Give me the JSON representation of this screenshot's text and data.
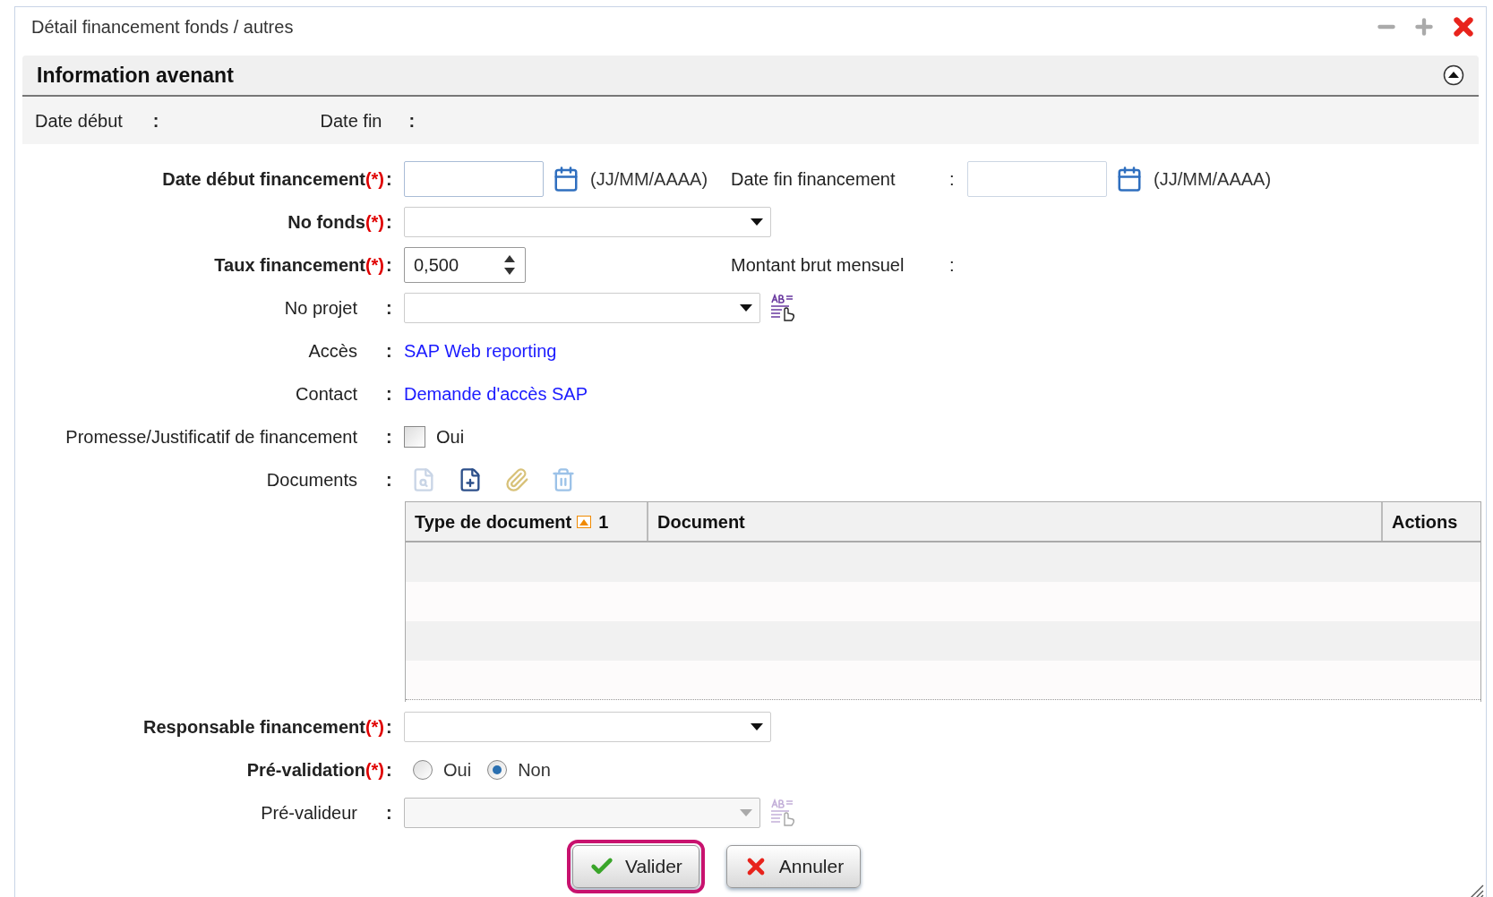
{
  "window": {
    "title": "Détail financement fonds / autres"
  },
  "section": {
    "title": "Information avenant",
    "expanded": true
  },
  "summary": [
    {
      "label": "Date début",
      "colon": ":"
    },
    {
      "label": "Date fin",
      "colon": ":"
    }
  ],
  "rows": [
    {
      "kind": "date",
      "label": "Date début financement",
      "required_mark": "(*)",
      "colon": ":",
      "hint": "(JJ/MM/AAAA)",
      "extra": {
        "kind": "date",
        "label": "Date fin financement",
        "colon": ":",
        "hint": "(JJ/MM/AAAA)"
      }
    },
    {
      "kind": "select",
      "label": "No fonds",
      "required_mark": "(*)",
      "colon": ":"
    },
    {
      "kind": "spinner",
      "label": "Taux financement",
      "required_mark": "(*)",
      "colon": ":",
      "value": "0,500",
      "extra": {
        "kind": "text",
        "label": "Montant brut mensuel",
        "colon": ":"
      }
    },
    {
      "kind": "lookup",
      "label": "No projet",
      "colon": ":",
      "disabled": false
    },
    {
      "kind": "link",
      "label": "Accès",
      "colon": ":",
      "link": "SAP Web reporting"
    },
    {
      "kind": "link",
      "label": "Contact",
      "colon": ":",
      "link": "Demande d'accès SAP"
    },
    {
      "kind": "checkbox",
      "label": "Promesse/Justificatif de financement",
      "colon": ":",
      "option": "Oui",
      "checked": false
    },
    {
      "kind": "documents",
      "label": "Documents",
      "colon": ":",
      "table": {
        "columns": [
          {
            "label": "Type de document",
            "sort_order": "1"
          },
          {
            "label": "Document"
          },
          {
            "label": "Actions"
          }
        ]
      }
    },
    {
      "kind": "select",
      "label": "Responsable financement",
      "required_mark": "(*)",
      "colon": ":"
    },
    {
      "kind": "radio",
      "label": "Pré-validation",
      "required_mark": "(*)",
      "colon": ":",
      "options": [
        {
          "label": "Oui",
          "selected": false
        },
        {
          "label": "Non",
          "selected": true
        }
      ]
    },
    {
      "kind": "lookup",
      "label": "Pré-valideur",
      "colon": ":",
      "disabled": true
    }
  ],
  "buttons": [
    {
      "kind": "confirm",
      "label": "Valider",
      "focused": true
    },
    {
      "kind": "cancel",
      "label": "Annuler",
      "focused": false
    }
  ]
}
